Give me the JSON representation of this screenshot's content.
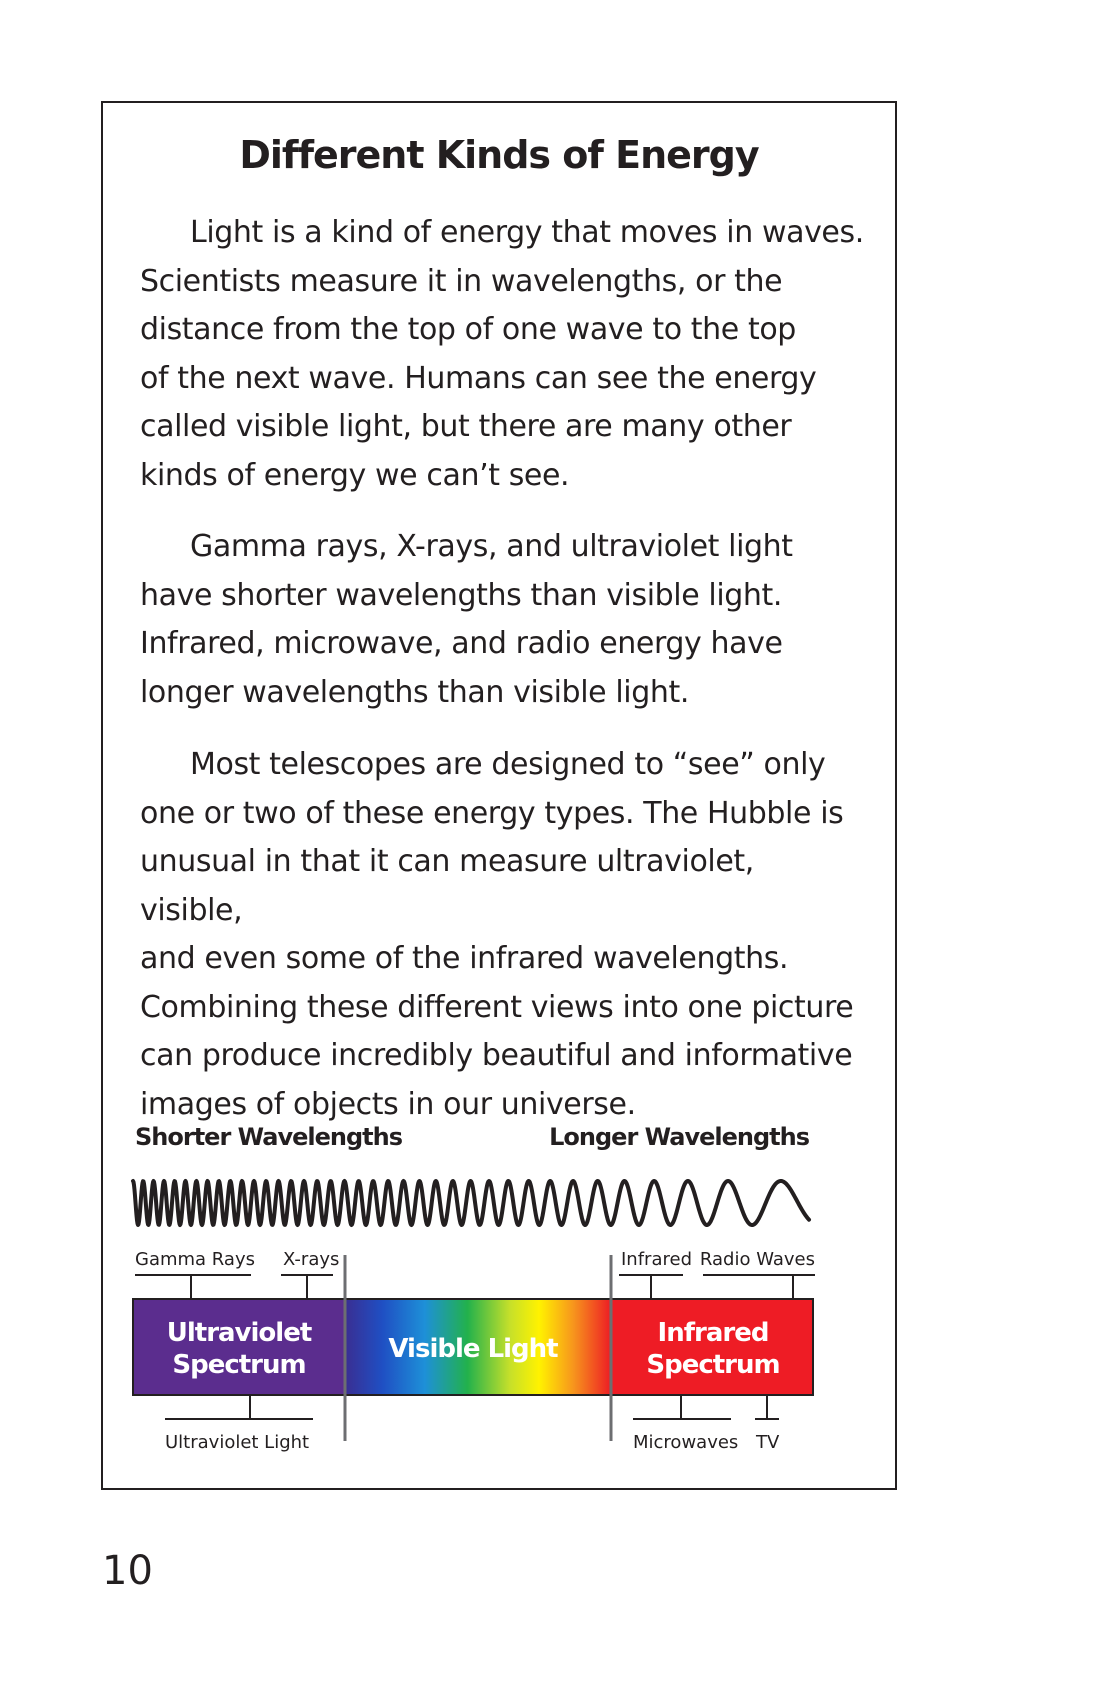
{
  "title": "Different Kinds of Energy",
  "paragraphs": [
    [
      "Light is a kind of energy that moves in waves.",
      "Scientists measure it in wavelengths, or the",
      "distance from the top of one wave to the top",
      "of the next wave. Humans can see the energy",
      "called visible light, but there are many other",
      "kinds of energy we can’t see."
    ],
    [
      "Gamma rays, X-rays, and ultraviolet light",
      "have shorter wavelengths than visible light.",
      "Infrared, microwave, and radio energy have",
      "longer wavelengths than visible light."
    ],
    [
      "Most telescopes are designed to “see” only",
      "one or two of these energy types. The Hubble is",
      "unusual in that it can measure ultraviolet, visible,",
      "and even some of the infrared wavelengths.",
      "Combining these different views into one picture",
      "can produce incredibly beautiful and informative",
      "images of objects in our universe."
    ]
  ],
  "diagram": {
    "shorter_label": "Shorter Wavelengths",
    "longer_label": "Longer Wavelengths",
    "top_labels": {
      "gamma": "Gamma Rays",
      "xrays": "X-rays",
      "infrared": "Infrared",
      "radio": "Radio Waves"
    },
    "bands": {
      "ultraviolet": [
        "Ultraviolet",
        "Spectrum"
      ],
      "visible": "Visible Light",
      "infrared": [
        "Infrared",
        "Spectrum"
      ]
    },
    "bottom_labels": {
      "uv_light": "Ultraviolet Light",
      "microwaves": "Microwaves",
      "tv": "TV"
    },
    "colors": {
      "uv": "#5b2d8e",
      "ir": "#ee1c25"
    }
  },
  "page_number": "10"
}
